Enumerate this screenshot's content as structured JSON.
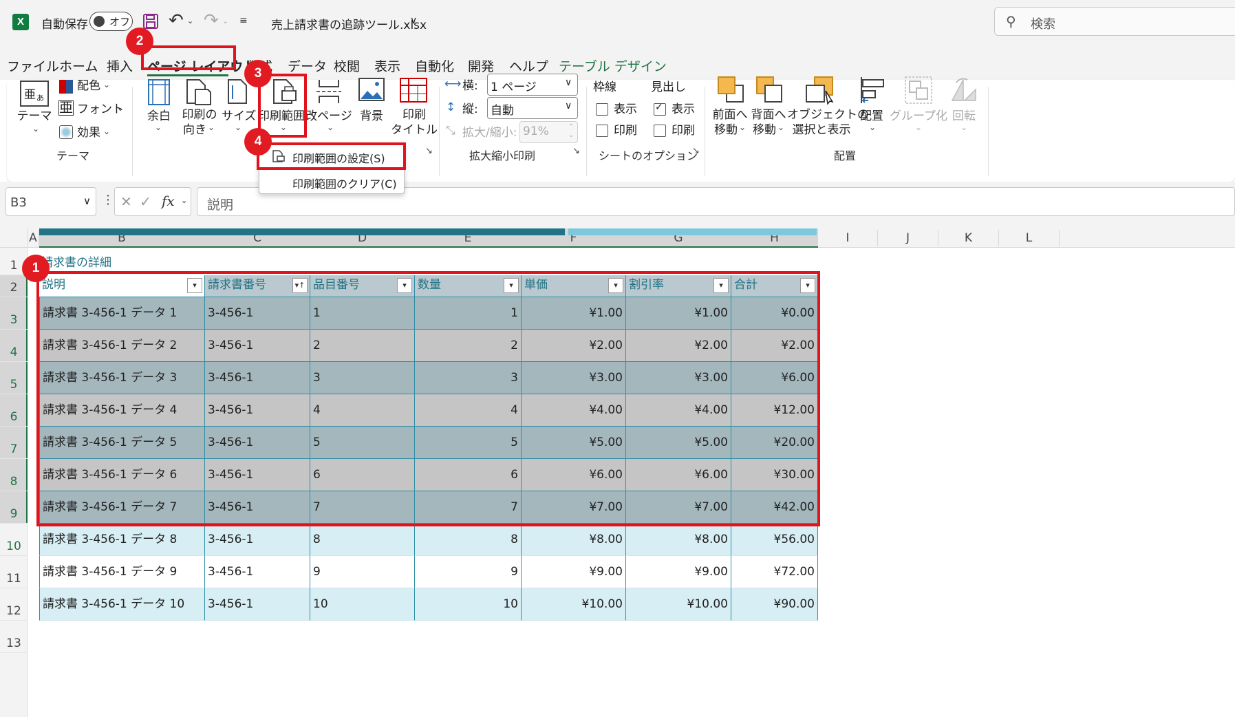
{
  "titlebar": {
    "autosave_label": "自動保存",
    "autosave_state": "オフ",
    "filename": "売上請求書の追跡ツール.xlsx",
    "search_placeholder": "検索"
  },
  "tabs": [
    "ファイル",
    "ホーム",
    "挿入",
    "ページ レイアウト",
    "数式",
    "データ",
    "校閲",
    "表示",
    "自動化",
    "開発",
    "ヘルプ",
    "テーブル デザイン"
  ],
  "ribbon": {
    "theme": {
      "theme_label": "テーマ",
      "colors": "配色",
      "fonts": "フォント",
      "effects": "効果",
      "group": "テーマ"
    },
    "page_setup": {
      "margins": "余白",
      "orientation_1": "印刷の",
      "orientation_2": "向き",
      "size": "サイズ",
      "print_area": "印刷範囲",
      "breaks": "改ページ",
      "background": "背景",
      "titles_1": "印刷",
      "titles_2": "タイトル"
    },
    "scale": {
      "width_label": "横:",
      "width_value": "1 ページ",
      "height_label": "縦:",
      "height_value": "自動",
      "scale_label": "拡大/縮小:",
      "scale_value": "91%",
      "group": "拡大縮小印刷"
    },
    "sheet_options": {
      "gridlines": "枠線",
      "headings": "見出し",
      "view": "表示",
      "print": "印刷",
      "group": "シートのオプション"
    },
    "arrange": {
      "bring_forward_1": "前面へ",
      "bring_forward_2": "移動",
      "send_backward_1": "背面へ",
      "send_backward_2": "移動",
      "selection_1": "オブジェクトの",
      "selection_2": "選択と表示",
      "align": "配置",
      "group_btn": "グループ化",
      "rotate": "回転",
      "group": "配置"
    }
  },
  "dropdown": {
    "set_print_area": "印刷範囲の設定(S)",
    "clear_print_area": "印刷範囲のクリア(C)"
  },
  "formula_bar": {
    "name_box": "B3",
    "fx": "fx",
    "content": "説明"
  },
  "columns": [
    "A",
    "B",
    "C",
    "D",
    "E",
    "F",
    "G",
    "H",
    "I",
    "J",
    "K",
    "L"
  ],
  "rows": [
    "1",
    "2",
    "3",
    "4",
    "5",
    "6",
    "7",
    "8",
    "9",
    "10",
    "11",
    "12",
    "13"
  ],
  "sheet": {
    "section_title": "請求書の詳細",
    "headers": [
      "説明",
      "請求書番号",
      "品目番号",
      "数量",
      "単価",
      "割引率",
      "合計"
    ],
    "data": [
      [
        "請求書 3-456-1 データ 1",
        "3-456-1",
        "1",
        "1",
        "¥1.00",
        "¥1.00",
        "¥0.00"
      ],
      [
        "請求書 3-456-1 データ 2",
        "3-456-1",
        "2",
        "2",
        "¥2.00",
        "¥2.00",
        "¥2.00"
      ],
      [
        "請求書 3-456-1 データ 3",
        "3-456-1",
        "3",
        "3",
        "¥3.00",
        "¥3.00",
        "¥6.00"
      ],
      [
        "請求書 3-456-1 データ 4",
        "3-456-1",
        "4",
        "4",
        "¥4.00",
        "¥4.00",
        "¥12.00"
      ],
      [
        "請求書 3-456-1 データ 5",
        "3-456-1",
        "5",
        "5",
        "¥5.00",
        "¥5.00",
        "¥20.00"
      ],
      [
        "請求書 3-456-1 データ 6",
        "3-456-1",
        "6",
        "6",
        "¥6.00",
        "¥6.00",
        "¥30.00"
      ],
      [
        "請求書 3-456-1 データ 7",
        "3-456-1",
        "7",
        "7",
        "¥7.00",
        "¥7.00",
        "¥42.00"
      ],
      [
        "請求書 3-456-1 データ 8",
        "3-456-1",
        "8",
        "8",
        "¥8.00",
        "¥8.00",
        "¥56.00"
      ],
      [
        "請求書 3-456-1 データ 9",
        "3-456-1",
        "9",
        "9",
        "¥9.00",
        "¥9.00",
        "¥72.00"
      ],
      [
        "請求書 3-456-1 データ 10",
        "3-456-1",
        "10",
        "10",
        "¥10.00",
        "¥10.00",
        "¥90.00"
      ]
    ]
  },
  "badges": [
    "1",
    "2",
    "3",
    "4"
  ],
  "colors": {
    "accent_dark": "#217386",
    "accent_light": "#7ec8dd",
    "row_band_light": "#d7eef4",
    "selection_dark": "#a3b7bd",
    "selection_light": "#c5c5c5",
    "annotation_red": "#e0141c"
  }
}
